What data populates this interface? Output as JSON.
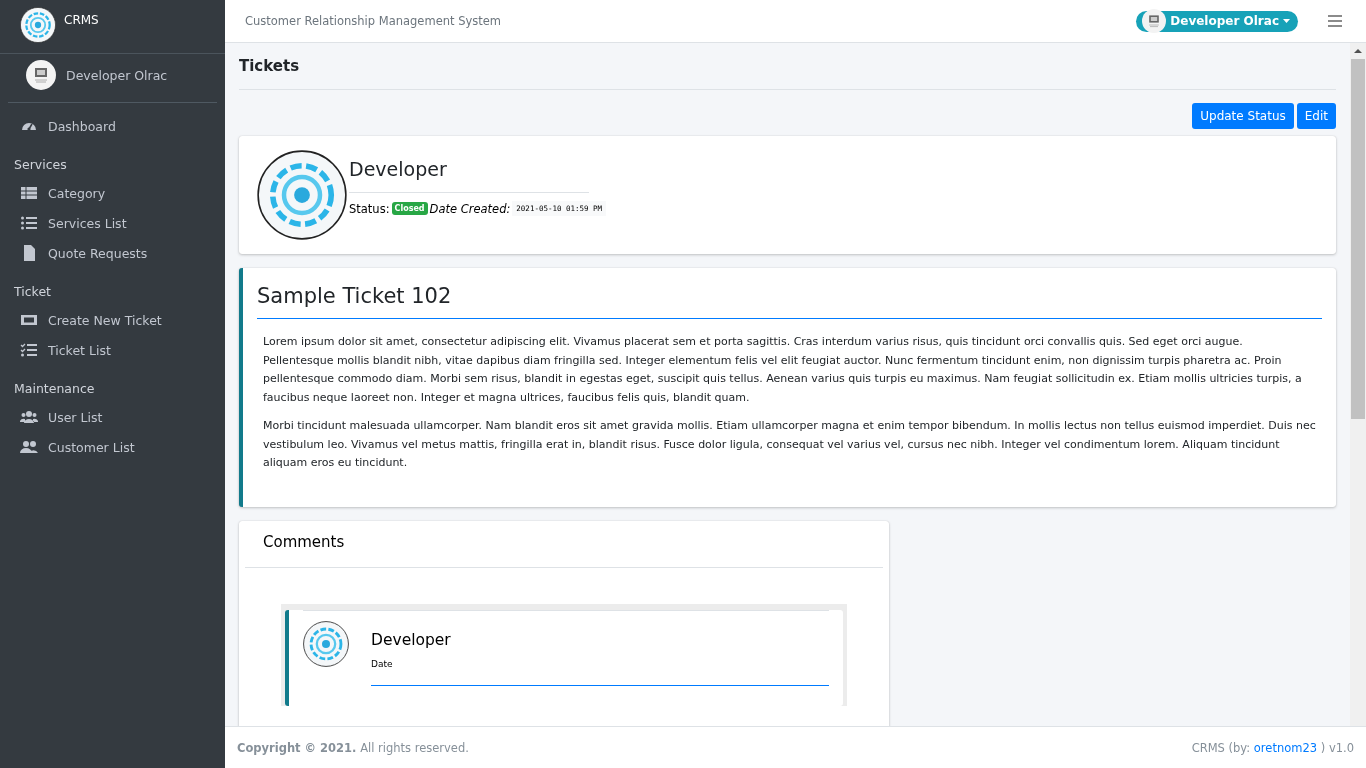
{
  "sidebar": {
    "brand": "CRMS",
    "user": "Developer Olrac",
    "sections": [
      {
        "items": [
          {
            "label": "Dashboard",
            "selected": false
          }
        ]
      },
      {
        "header": "Services",
        "items": [
          {
            "label": "Category",
            "selected": false
          },
          {
            "label": "Services List",
            "selected": false
          },
          {
            "label": "Quote Requests",
            "selected": false
          }
        ]
      },
      {
        "header": "Ticket",
        "items": [
          {
            "label": "Create New Ticket",
            "selected": false
          },
          {
            "label": "Ticket List",
            "selected": false
          }
        ]
      },
      {
        "header": "Maintenance",
        "items": [
          {
            "label": "User List",
            "selected": false
          },
          {
            "label": "Customer List",
            "selected": false
          }
        ]
      }
    ]
  },
  "topbar": {
    "title": "Customer Relationship Management System",
    "user": "Developer Olrac"
  },
  "page": {
    "title": "Tickets",
    "buttons": [
      "Update Status",
      "Edit"
    ]
  },
  "profile": {
    "name": "Developer",
    "status_label": "Status:",
    "status": "Closed",
    "date_label": "Date Created:",
    "date": "2021-05-10 01:59 PM"
  },
  "ticket": {
    "title": "Sample Ticket 102",
    "paragraphs": [
      "Lorem ipsum dolor sit amet, consectetur adipiscing elit. Vivamus placerat sem et porta sagittis. Cras interdum varius risus, quis tincidunt orci convallis quis. Sed eget orci augue. Pellentesque mollis blandit nibh, vitae dapibus diam fringilla sed. Integer elementum felis vel elit feugiat auctor. Nunc fermentum tincidunt enim, non dignissim turpis pharetra ac. Proin pellentesque commodo diam. Morbi sem risus, blandit in egestas eget, suscipit quis tellus. Aenean varius quis turpis eu maximus. Nam feugiat sollicitudin ex. Etiam mollis ultricies turpis, a faucibus neque laoreet non. Integer et magna ultrices, faucibus felis quis, blandit quam.",
      "Morbi tincidunt malesuada ullamcorper. Nam blandit eros sit amet gravida mollis. Etiam ullamcorper magna et enim tempor bibendum. In mollis lectus non tellus euismod imperdiet. Duis nec vestibulum leo. Vivamus vel metus mattis, fringilla erat in, blandit risus. Fusce dolor ligula, consequat vel varius vel, cursus nec nibh. Integer vel condimentum lorem. Aliquam tincidunt aliquam eros eu tincidunt."
    ]
  },
  "comments": {
    "title": "Comments",
    "items": [
      {
        "name": "Developer",
        "date": "Date"
      }
    ]
  },
  "footer": {
    "copyright": "**Copyright © 2021.** All rights reserved.",
    "credit_prefix": "CRMS (by: ",
    "credit_link": "oretnom23",
    "credit_suffix": " ) v1.0"
  }
}
